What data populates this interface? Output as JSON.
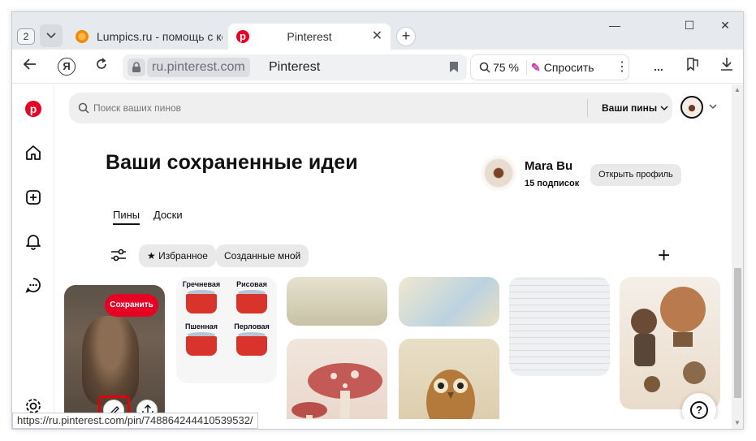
{
  "browser": {
    "tab_count": "2",
    "tabs": [
      {
        "title": "Lumpics.ru - помощь с ком",
        "favicon": "orange-circle-icon"
      },
      {
        "title": "Pinterest",
        "favicon": "pinterest-icon",
        "active": true
      }
    ],
    "address": {
      "domain": "ru.pinterest.com",
      "page_title": "Pinterest"
    },
    "zoom": "75 %",
    "ask_label": "Спросить",
    "more_label": "...",
    "status_url": "https://ru.pinterest.com/pin/748864244410539532/"
  },
  "pinterest": {
    "search_placeholder": "Поиск ваших пинов",
    "boards_dropdown": "Ваши пины",
    "heading": "Ваши сохраненные идеи",
    "profile": {
      "name": "Mara Bu",
      "subscriptions": "15 подписок",
      "open_button": "Открыть профиль"
    },
    "tabs": [
      "Пины",
      "Доски"
    ],
    "filters": {
      "favorites": "Избранное",
      "created": "Созданные мной"
    },
    "pin_actions": {
      "save": "Сохранить"
    },
    "pots": [
      "Гречневая",
      "Рисовая",
      "Пшенная",
      "Перловая"
    ]
  },
  "colors": {
    "brand": "#e60023",
    "highlight": "#e3000b"
  }
}
